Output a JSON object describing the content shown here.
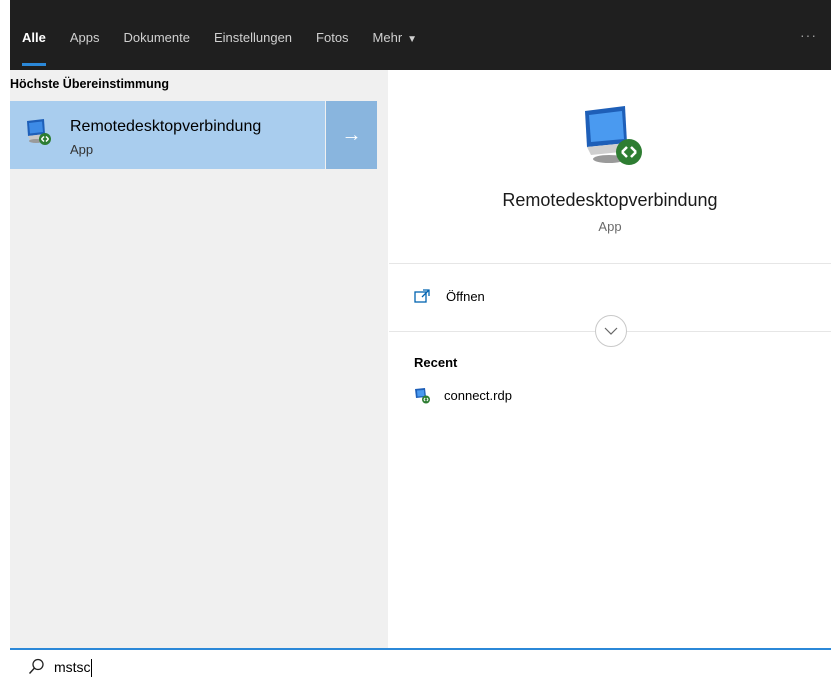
{
  "tabs": [
    {
      "label": "Alle",
      "active": true
    },
    {
      "label": "Apps"
    },
    {
      "label": "Dokumente"
    },
    {
      "label": "Einstellungen"
    },
    {
      "label": "Fotos"
    },
    {
      "label": "Mehr",
      "caret": "▼"
    }
  ],
  "more_options": "···",
  "left": {
    "section_title": "Höchste Übereinstimmung",
    "best_match": {
      "title": "Remotedesktopverbindung",
      "subtitle": "App",
      "arrow": "→",
      "icon": "remote-desktop-icon"
    }
  },
  "right": {
    "app_title": "Remotedesktopverbindung",
    "app_subtitle": "App",
    "open_label": "Öffnen",
    "recent_header": "Recent",
    "recent_items": [
      {
        "label": "connect.rdp",
        "icon": "rdp-file-icon"
      }
    ]
  },
  "search": {
    "value": "mstsc"
  },
  "colors": {
    "accent": "#2b88d8",
    "selection": "#a9cdee",
    "selection_arrow": "#89b5de",
    "topbar": "#1f1f1f"
  }
}
